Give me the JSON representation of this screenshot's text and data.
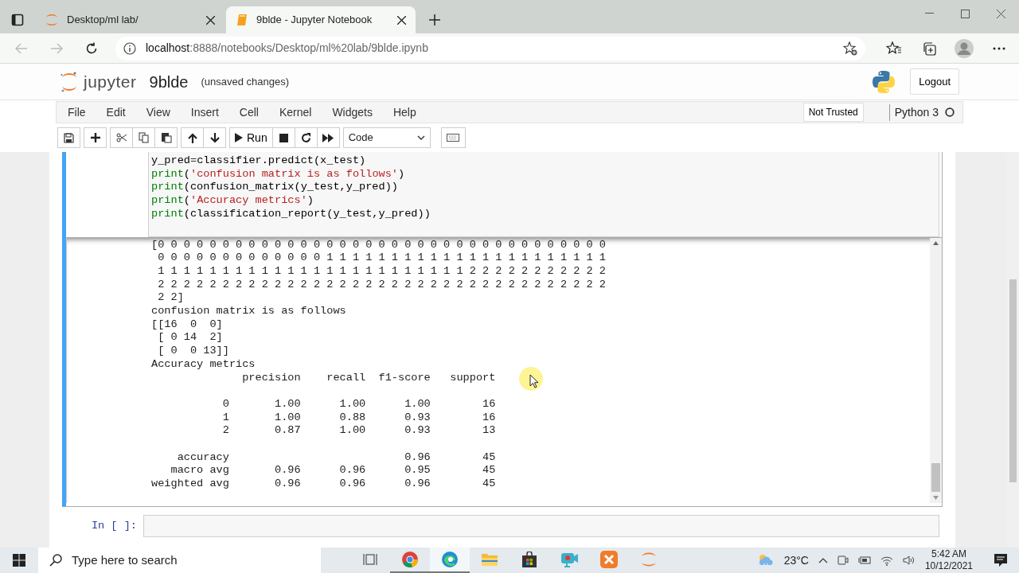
{
  "browser": {
    "tabs": [
      {
        "title": "Desktop/ml lab/",
        "selected": false
      },
      {
        "title": "9blde - Jupyter Notebook",
        "selected": true
      }
    ],
    "url": {
      "host": "localhost",
      "rest": ":8888/notebooks/Desktop/ml%20lab/9blde.ipynb"
    }
  },
  "header": {
    "logo_text": "jupyter",
    "notebook_name": "9blde",
    "save_status": "(unsaved changes)",
    "logout": "Logout"
  },
  "menu": [
    "File",
    "Edit",
    "View",
    "Insert",
    "Cell",
    "Kernel",
    "Widgets",
    "Help"
  ],
  "trust": "Not Trusted",
  "kernel": "Python 3",
  "toolbar": {
    "run": "Run",
    "cell_type": "Code"
  },
  "cell": {
    "code": [
      [
        {
          "text": "y_pred",
          "kind": "name"
        },
        {
          "text": "=",
          "kind": "operator"
        },
        {
          "text": "classifier.predict(x_test)",
          "kind": "name"
        }
      ],
      [
        {
          "text": "print",
          "kind": "builtin"
        },
        {
          "text": "(",
          "kind": "name"
        },
        {
          "text": "'confusion matrix is as follows'",
          "kind": "string"
        },
        {
          "text": ")",
          "kind": "name"
        }
      ],
      [
        {
          "text": "print",
          "kind": "builtin"
        },
        {
          "text": "(confusion_matrix(y_test,y_pred))",
          "kind": "name"
        }
      ],
      [
        {
          "text": "print",
          "kind": "builtin"
        },
        {
          "text": "(",
          "kind": "name"
        },
        {
          "text": "'Accuracy metrics'",
          "kind": "string"
        },
        {
          "text": ")",
          "kind": "name"
        }
      ],
      [
        {
          "text": "print",
          "kind": "builtin"
        },
        {
          "text": "(classification_report(y_test,y_pred))",
          "kind": "name"
        }
      ]
    ],
    "output": [
      {
        "lines": [
          "[0 0 0 0 0 0 0 0 0 0 0 0 0 0 0 0 0 0 0 0 0 0 0 0 0 0 0 0 0 0 0 0 0 0 0",
          " 0 0 0 0 0 0 0 0 0 0 0 0 0 1 1 1 1 1 1 1 1 1 1 1 1 1 1 1 1 1 1 1 1 1 1",
          " 1 1 1 1 1 1 1 1 1 1 1 1 1 1 1 1 1 1 1 1 1 1 1 1 2 2 2 2 2 2 2 2 2 2 2",
          " 2 2 2 2 2 2 2 2 2 2 2 2 2 2 2 2 2 2 2 2 2 2 2 2 2 2 2 2 2 2 2 2 2 2 2",
          " 2 2]",
          "confusion matrix is as follows",
          "[[16  0  0]",
          " [ 0 14  2]",
          " [ 0  0 13]]",
          "Accuracy metrics",
          "              precision    recall  f1-score   support"
        ]
      },
      {
        "lines": [
          "           0       1.00      1.00      1.00        16",
          "           1       1.00      0.88      0.93        16",
          "           2       0.87      1.00      0.93        13"
        ]
      },
      {
        "lines": [
          "    accuracy                           0.96        45",
          "   macro avg       0.96      0.96      0.95        45",
          "weighted avg       0.96      0.96      0.96        45"
        ]
      }
    ]
  },
  "next_cell": {
    "prompt": "In [ ]:"
  },
  "taskbar": {
    "search_placeholder": "Type here to search",
    "apps": [
      {
        "kind": "taskview",
        "running": false,
        "active": false
      },
      {
        "kind": "chrome",
        "running": true,
        "active": false
      },
      {
        "kind": "edge",
        "running": true,
        "active": true
      },
      {
        "kind": "folder",
        "running": false,
        "active": false
      },
      {
        "kind": "store",
        "running": false,
        "active": false
      },
      {
        "kind": "recorder",
        "running": false,
        "active": false
      },
      {
        "kind": "xampp",
        "running": false,
        "active": false
      },
      {
        "kind": "jupyter",
        "running": false,
        "active": false
      }
    ],
    "weather": "23°C",
    "time": "5:42 AM",
    "date": "10/12/2021"
  }
}
